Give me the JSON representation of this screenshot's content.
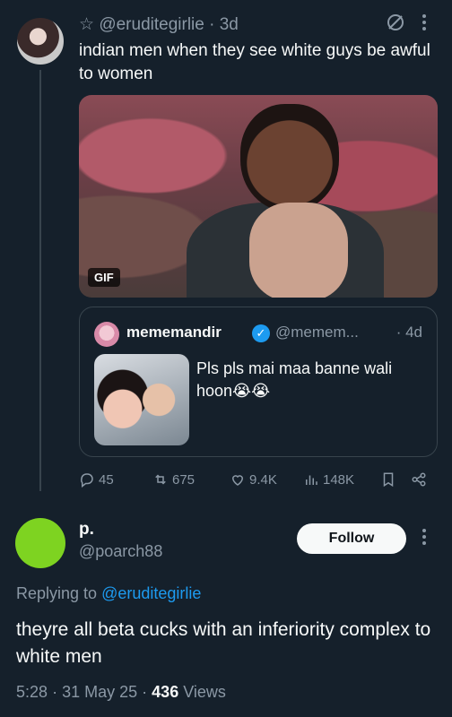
{
  "top_tweet": {
    "star": "☆",
    "handle": "@eruditegirlie",
    "dot": "·",
    "age": "3d",
    "text": "indian men when they see white guys be awful to women",
    "gif_badge": "GIF"
  },
  "quote": {
    "name": "mememandir",
    "handle": "@memem...",
    "age": "· 4d",
    "text": "Pls pls mai maa banne wali hoon😭😭"
  },
  "actions": {
    "replies": "45",
    "reposts": "675",
    "likes": "9.4K",
    "views": "148K"
  },
  "reply": {
    "name": "p.",
    "handle": "@poarch88",
    "follow_label": "Follow",
    "replying_prefix": "Replying to ",
    "replying_handle": "@eruditegirlie",
    "text": "theyre all beta cucks with an inferiority complex to white men",
    "time": "5:28",
    "date": "31 May 25",
    "views_count": "436",
    "views_label": "Views"
  },
  "colors": {
    "background": "#15202b",
    "accent": "#1d9bf0",
    "muted": "#8b98a5",
    "reply_avatar": "#7ed321"
  }
}
